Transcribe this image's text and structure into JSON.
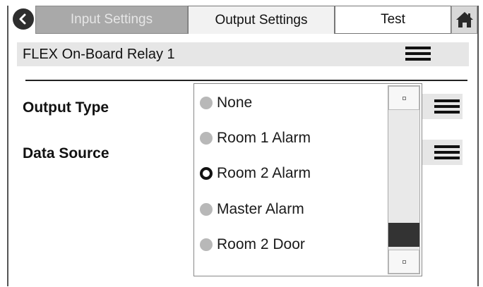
{
  "tabs": {
    "input_settings": "Input Settings",
    "output_settings": "Output Settings",
    "test": "Test"
  },
  "relay": {
    "title": "FLEX On-Board Relay 1"
  },
  "fields": {
    "output_type_label": "Output Type",
    "data_source_label": "Data Source"
  },
  "dropdown": {
    "options": [
      {
        "label": "None",
        "selected": false
      },
      {
        "label": "Room 1 Alarm",
        "selected": false
      },
      {
        "label": "Room 2 Alarm",
        "selected": true
      },
      {
        "label": "Master Alarm",
        "selected": false
      },
      {
        "label": "Room 2 Door",
        "selected": false
      }
    ]
  },
  "icons": {
    "back": "back-arrow-icon",
    "home": "home-icon",
    "menu": "hamburger-menu-icon"
  },
  "colors": {
    "inactive_tab": "#a9a9a9",
    "active_tab": "#f2f2f2",
    "field_strip": "#e6e6e6",
    "scroll_thumb": "#333333"
  }
}
